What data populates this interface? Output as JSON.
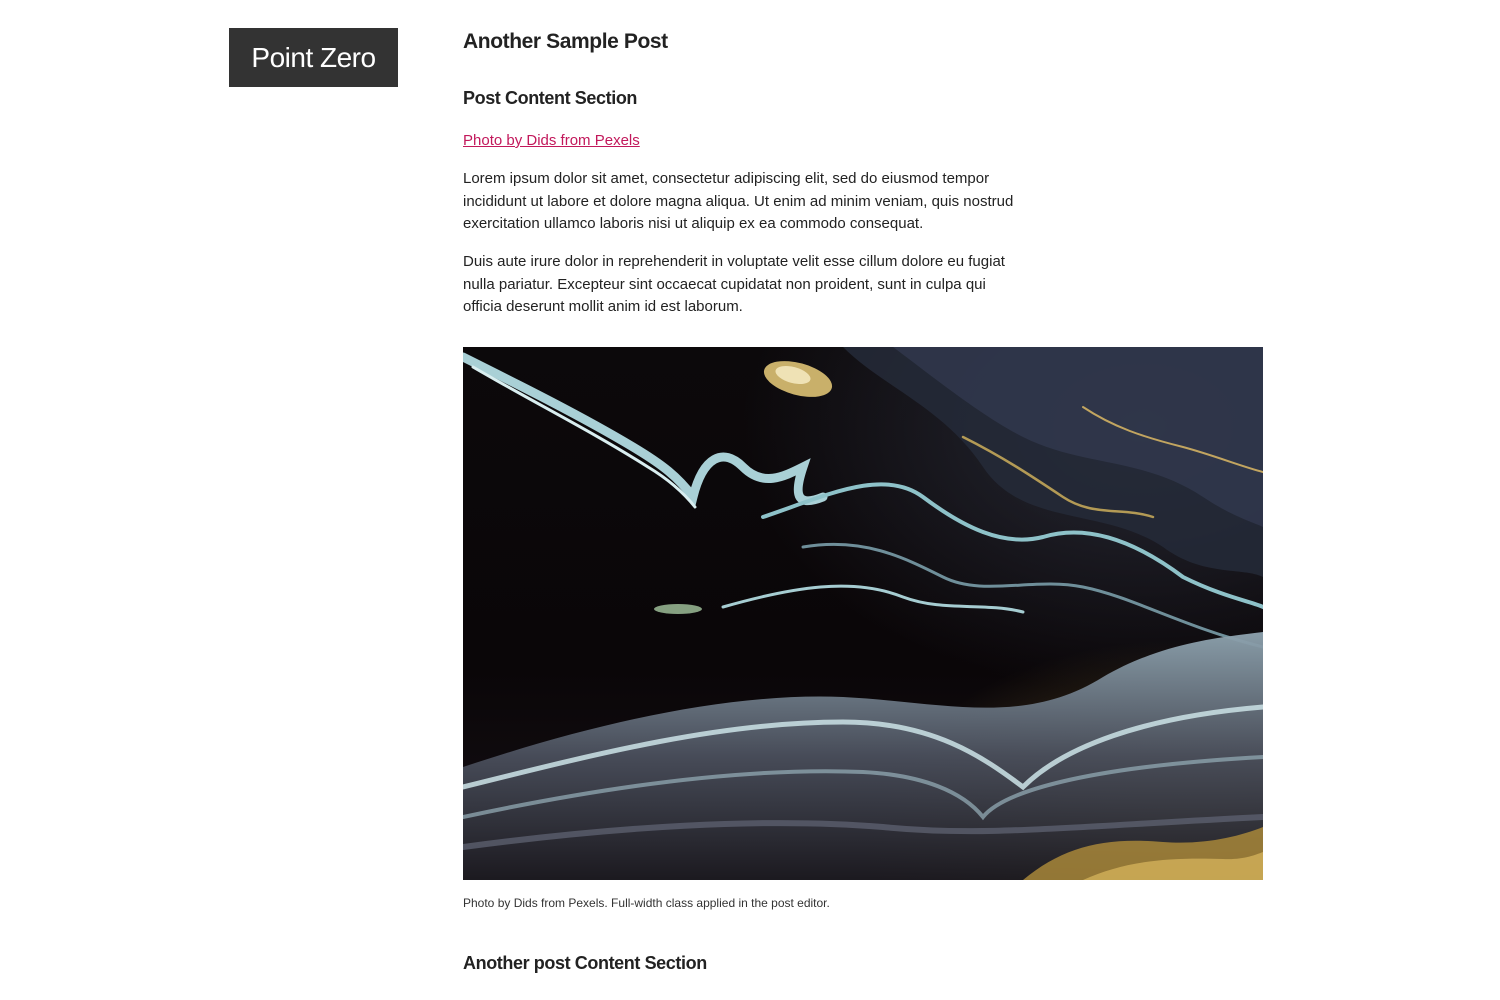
{
  "site": {
    "title": "Point Zero"
  },
  "post": {
    "title": "Another Sample Post",
    "sections": [
      {
        "heading": "Post Content Section"
      },
      {
        "heading": "Another post Content Section"
      }
    ],
    "photo_credit_link": "Photo by Dids from Pexels",
    "paragraphs": [
      "Lorem ipsum dolor sit amet, consectetur adipiscing elit, sed do eiusmod tempor incididunt ut labore et dolore magna aliqua. Ut enim ad minim veniam, quis nostrud exercitation ullamco laboris nisi ut aliquip ex ea commodo consequat.",
      "Duis aute irure dolor in reprehenderit in voluptate velit esse cillum dolore eu fugiat nulla pariatur. Excepteur sint occaecat cupidatat non proident, sunt in culpa qui officia deserunt mollit anim id est laborum."
    ],
    "figure": {
      "caption": "Photo by Dids from Pexels. Full-width class applied in the post editor."
    }
  },
  "colors": {
    "logo_background": "#333333",
    "link": "#c2185b",
    "text": "#222222"
  }
}
